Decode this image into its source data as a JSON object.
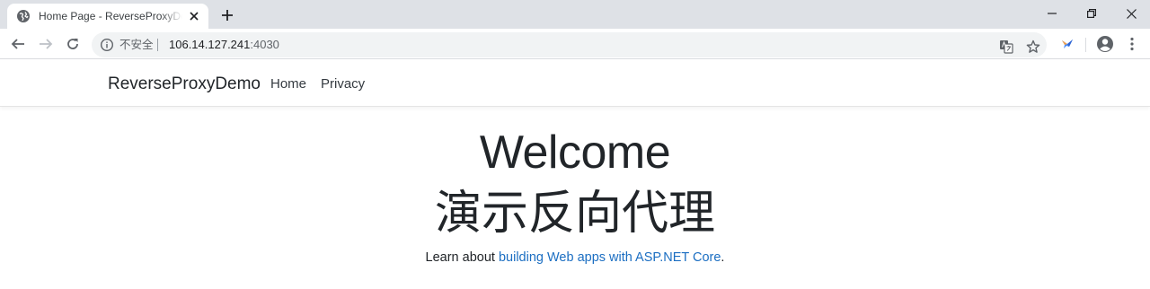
{
  "browser": {
    "tab_title": "Home Page - ReverseProxyDemo",
    "icons": {
      "favicon": "globe-icon",
      "close": "close-icon",
      "new_tab": "plus-icon",
      "minimize": "minimize-icon",
      "restore": "restore-icon",
      "window_close": "close-icon",
      "back": "arrow-left-icon",
      "forward": "arrow-right-icon",
      "reload": "reload-icon",
      "info": "info-icon",
      "translate": "translate-icon",
      "bookmark": "star-icon",
      "extension": "bird-extension-icon",
      "profile": "account-icon",
      "menu": "kebab-menu-icon"
    },
    "security_label": "不安全",
    "url_host": "106.14.127.241",
    "url_port": ":4030"
  },
  "site": {
    "brand": "ReverseProxyDemo",
    "nav": [
      {
        "label": "Home"
      },
      {
        "label": "Privacy"
      }
    ]
  },
  "main": {
    "heading": "Welcome",
    "subheading": "演示反向代理",
    "learn_prefix": "Learn about ",
    "learn_link": "building Web apps with ASP.NET Core",
    "learn_suffix": "."
  },
  "colors": {
    "link": "#1b6ec2",
    "tabstrip": "#dee1e6",
    "omnibox": "#f1f3f4"
  }
}
